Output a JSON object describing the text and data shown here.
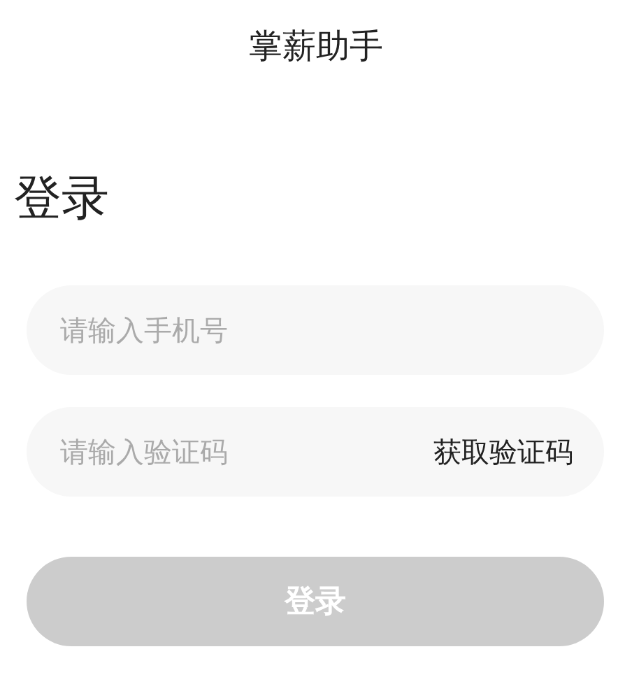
{
  "header": {
    "title": "掌薪助手"
  },
  "heading": "登录",
  "fields": [
    {
      "kind": "text",
      "placeholder": "请输入手机号"
    },
    {
      "kind": "code",
      "placeholder": "请输入验证码",
      "action": "获取验证码"
    }
  ],
  "submit": {
    "label": "登录",
    "disabled": true
  }
}
